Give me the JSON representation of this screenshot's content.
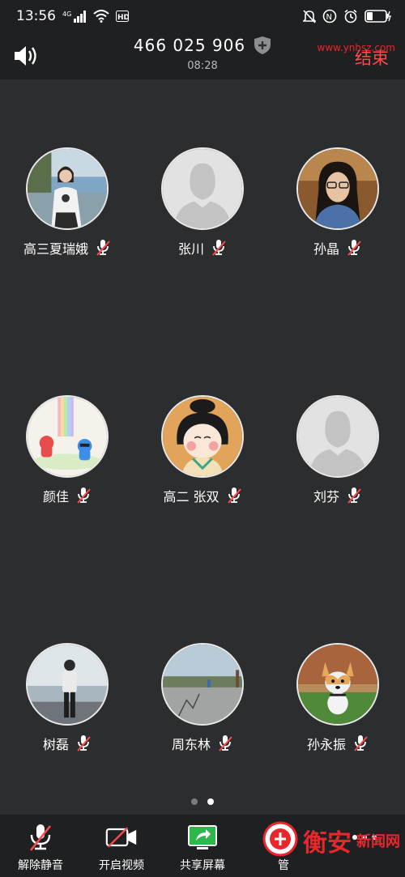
{
  "status_bar": {
    "time": "13:56",
    "network": "4G",
    "hd": "HD"
  },
  "header": {
    "meeting_id": "466 025 906",
    "timer": "08:28",
    "end_label": "结束"
  },
  "participants": [
    {
      "name": "高三夏瑞娥",
      "avatar": "photo-woman-seaside"
    },
    {
      "name": "张川",
      "avatar": "default-avatar"
    },
    {
      "name": "孙晶",
      "avatar": "photo-woman-glasses"
    },
    {
      "name": "颜佳",
      "avatar": "cartoon-rainbow"
    },
    {
      "name": "高二 张双",
      "avatar": "cartoon-girl"
    },
    {
      "name": "刘芬",
      "avatar": "default-avatar"
    },
    {
      "name": "树磊",
      "avatar": "photo-man-beach"
    },
    {
      "name": "周东林",
      "avatar": "photo-road"
    },
    {
      "name": "孙永振",
      "avatar": "photo-corgi"
    }
  ],
  "pagination": {
    "pages": 2,
    "current": 2
  },
  "toolbar": {
    "unmute": "解除静音",
    "start_video": "开启视频",
    "share_screen": "共享屏幕",
    "manage_partial": "管"
  },
  "watermark": {
    "brand": "衡安",
    "news": "新闻网",
    "site": "www.ynhsz.com"
  },
  "colors": {
    "end": "#ff4a4a",
    "share": "#2db84d",
    "mic_off": "#ff4a4a",
    "watermark": "#e8262c"
  }
}
